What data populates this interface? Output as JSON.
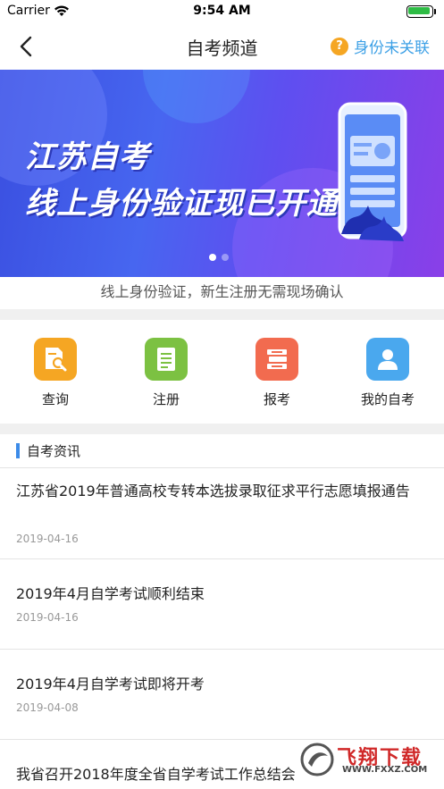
{
  "status_bar": {
    "carrier": "Carrier",
    "time": "9:54 AM"
  },
  "nav": {
    "title": "自考频道",
    "identity_status": "身份未关联",
    "identity_icon": "?"
  },
  "banner": {
    "headline_line1": "江苏自考",
    "headline_line2": "线上身份验证现已开通",
    "caption": "线上身份验证，新生注册无需现场确认",
    "slide_count": 2,
    "active_slide": 1
  },
  "quick_menu": [
    {
      "label": "查询",
      "icon": "search-document-icon",
      "color": "#f5a623"
    },
    {
      "label": "注册",
      "icon": "document-list-icon",
      "color": "#7cc142"
    },
    {
      "label": "报考",
      "icon": "books-stack-icon",
      "color": "#f26b4f"
    },
    {
      "label": "我的自考",
      "icon": "user-profile-icon",
      "color": "#4aa8ee"
    }
  ],
  "news": {
    "section_title": "自考资讯",
    "items": [
      {
        "title": "江苏省2019年普通高校专转本选拔录取征求平行志愿填报通告",
        "date": "2019-04-16"
      },
      {
        "title": "2019年4月自学考试顺利结束",
        "date": "2019-04-16"
      },
      {
        "title": "2019年4月自学考试即将开考",
        "date": "2019-04-08"
      },
      {
        "title": "我省召开2018年度全省自学考试工作总结会",
        "date": ""
      }
    ]
  },
  "watermark": {
    "brand": "飞翔下载",
    "url": "WWW.FXXZ.COM"
  }
}
